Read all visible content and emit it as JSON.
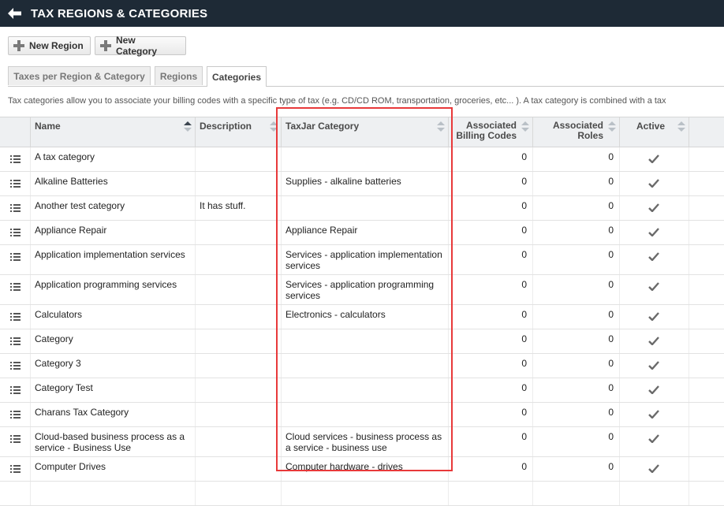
{
  "header": {
    "title": "TAX REGIONS & CATEGORIES",
    "back_icon": "back-arrow-icon"
  },
  "toolbar": {
    "new_region": "New Region",
    "new_category": "New Category"
  },
  "tabs": [
    {
      "label": "Taxes per Region & Category",
      "active": false
    },
    {
      "label": "Regions",
      "active": false
    },
    {
      "label": "Categories",
      "active": true
    }
  ],
  "description": "Tax categories allow you to associate your billing codes with a specific type of tax (e.g. CD/CD ROM, transportation, groceries, etc... ). A tax category is combined with a tax",
  "columns": {
    "name": "Name",
    "description": "Description",
    "taxjar": "TaxJar Category",
    "billing_codes": "Associated Billing Codes",
    "roles": "Associated Roles",
    "active": "Active"
  },
  "rows": [
    {
      "name": "A tax category",
      "description": "",
      "taxjar": "",
      "billing_codes": "0",
      "roles": "0",
      "active": true
    },
    {
      "name": "Alkaline Batteries",
      "description": "",
      "taxjar": "Supplies - alkaline batteries",
      "billing_codes": "0",
      "roles": "0",
      "active": true
    },
    {
      "name": "Another test category",
      "description": "It has stuff.",
      "taxjar": "",
      "billing_codes": "0",
      "roles": "0",
      "active": true
    },
    {
      "name": "Appliance Repair",
      "description": "",
      "taxjar": "Appliance Repair",
      "billing_codes": "0",
      "roles": "0",
      "active": true
    },
    {
      "name": "Application implementation services",
      "description": "",
      "taxjar": "Services - application implementation services",
      "billing_codes": "0",
      "roles": "0",
      "active": true
    },
    {
      "name": "Application programming services",
      "description": "",
      "taxjar": "Services - application programming services",
      "billing_codes": "0",
      "roles": "0",
      "active": true
    },
    {
      "name": "Calculators",
      "description": "",
      "taxjar": "Electronics - calculators",
      "billing_codes": "0",
      "roles": "0",
      "active": true
    },
    {
      "name": "Category",
      "description": "",
      "taxjar": "",
      "billing_codes": "0",
      "roles": "0",
      "active": true
    },
    {
      "name": "Category 3",
      "description": "",
      "taxjar": "",
      "billing_codes": "0",
      "roles": "0",
      "active": true
    },
    {
      "name": "Category Test",
      "description": "",
      "taxjar": "",
      "billing_codes": "0",
      "roles": "0",
      "active": true
    },
    {
      "name": "Charans Tax Category",
      "description": "",
      "taxjar": "",
      "billing_codes": "0",
      "roles": "0",
      "active": true
    },
    {
      "name": "Cloud-based business process as a service - Business Use",
      "description": "",
      "taxjar": "Cloud services - business process as a service - business use",
      "billing_codes": "0",
      "roles": "0",
      "active": true
    },
    {
      "name": "Computer Drives",
      "description": "",
      "taxjar": "Computer hardware - drives",
      "billing_codes": "0",
      "roles": "0",
      "active": true
    },
    {
      "name": "",
      "description": "",
      "taxjar": "",
      "billing_codes": "",
      "roles": "",
      "active": false
    }
  ],
  "colors": {
    "header_bg": "#1e2a36",
    "highlight": "#e8393a"
  }
}
